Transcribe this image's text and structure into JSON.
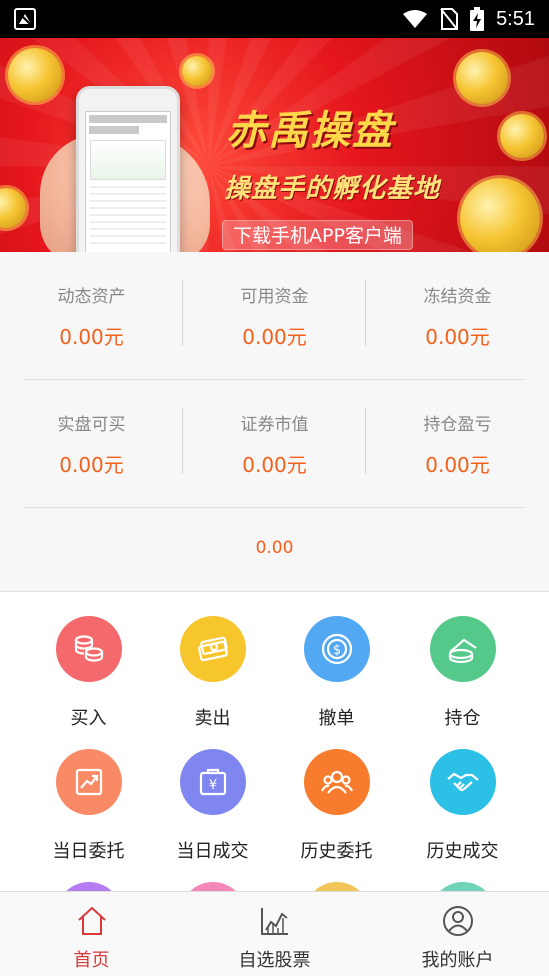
{
  "status_bar": {
    "time": "5:51",
    "icons": [
      "notification-icon",
      "wifi-icon",
      "no-sim-icon",
      "battery-charging-icon"
    ]
  },
  "banner": {
    "title": "赤禹操盘",
    "subtitle": "操盘手的孵化基地",
    "download_label": "下载手机APP客户端"
  },
  "assets": {
    "row1": [
      {
        "label": "动态资产",
        "value": "0.00元"
      },
      {
        "label": "可用资金",
        "value": "0.00元"
      },
      {
        "label": "冻结资金",
        "value": "0.00元"
      }
    ],
    "row2": [
      {
        "label": "实盘可买",
        "value": "0.00元"
      },
      {
        "label": "证券市值",
        "value": "0.00元"
      },
      {
        "label": "持仓盈亏",
        "value": "0.00元"
      }
    ],
    "total": "0.00"
  },
  "menu": [
    {
      "label": "买入",
      "icon": "coins-icon",
      "color": "#f4696b"
    },
    {
      "label": "卖出",
      "icon": "cash-icon",
      "color": "#f7c52c"
    },
    {
      "label": "撤单",
      "icon": "dollar-coin-icon",
      "color": "#52a8f3"
    },
    {
      "label": "持仓",
      "icon": "money-stack-icon",
      "color": "#55c98a"
    },
    {
      "label": "当日委托",
      "icon": "trend-chart-icon",
      "color": "#f98a66"
    },
    {
      "label": "当日成交",
      "icon": "yuan-wallet-icon",
      "color": "#7f86f0"
    },
    {
      "label": "历史委托",
      "icon": "people-icon",
      "color": "#f77c2e"
    },
    {
      "label": "历史成交",
      "icon": "handshake-icon",
      "color": "#2cc0e6"
    }
  ],
  "menu_partial_colors": [
    "#b57cf2",
    "#f488b8",
    "#f2c55a",
    "#6fd3b8"
  ],
  "bottom_nav": [
    {
      "label": "首页",
      "icon": "home-icon",
      "active": true
    },
    {
      "label": "自选股票",
      "icon": "stock-chart-icon",
      "active": false
    },
    {
      "label": "我的账户",
      "icon": "user-icon",
      "active": false
    }
  ],
  "colors": {
    "accent": "#f2601a",
    "active_nav": "#d83a3a",
    "banner_red": "#e5161c"
  }
}
